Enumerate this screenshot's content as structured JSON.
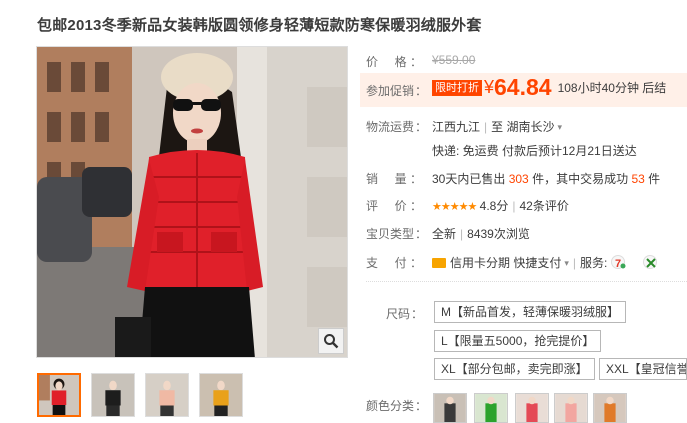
{
  "product": {
    "title": "包邮2013冬季新品女装韩版圆领修身轻薄短款防寒保暖羽绒服外套"
  },
  "price_row": {
    "label": "价",
    "label2": "格",
    "value": "¥559.00"
  },
  "promo_row": {
    "label": "参加促销",
    "tag": "限时打折",
    "yen": "¥",
    "price": "64.84",
    "countdown": "108小时40分钟 后结"
  },
  "shipping_row": {
    "label": "物流运费",
    "from": "江西九江",
    "to_prefix": "至",
    "to": "湖南长沙",
    "line2": "快递: 免运费 付款后预计12月21日送达"
  },
  "sales_row": {
    "label": "销",
    "label2": "量",
    "prefix": "30天内已售出",
    "count": "303",
    "mid": "件，其中交易成功",
    "success": "53",
    "suffix": "件"
  },
  "rating_row": {
    "label": "评",
    "label2": "价",
    "stars": "★★★★★",
    "score": "4.8分",
    "reviews": "42条评价"
  },
  "type_row": {
    "label": "宝贝类型",
    "value": "全新",
    "views": "8439次浏览"
  },
  "payment_row": {
    "label": "支",
    "label2": "付",
    "method": "信用卡分期",
    "quick": "快捷支付",
    "service_label": "服务:"
  },
  "size_row": {
    "label": "尺码",
    "options": [
      "M【新品首发，轻薄保暖羽绒服】",
      "L【限量五5000，抢完提价】",
      "XL【部分包邮，卖完即涨】",
      "XXL【皇冠信誉"
    ]
  },
  "color_row": {
    "label": "颜色分类"
  },
  "colors": {
    "accent": "#ff4400",
    "jacket_red": "#e0202a",
    "star": "#ff8a00"
  },
  "icons": [
    "search-zoom-icon",
    "credit-card-icon",
    "chevron-down-icon",
    "service-icon"
  ]
}
